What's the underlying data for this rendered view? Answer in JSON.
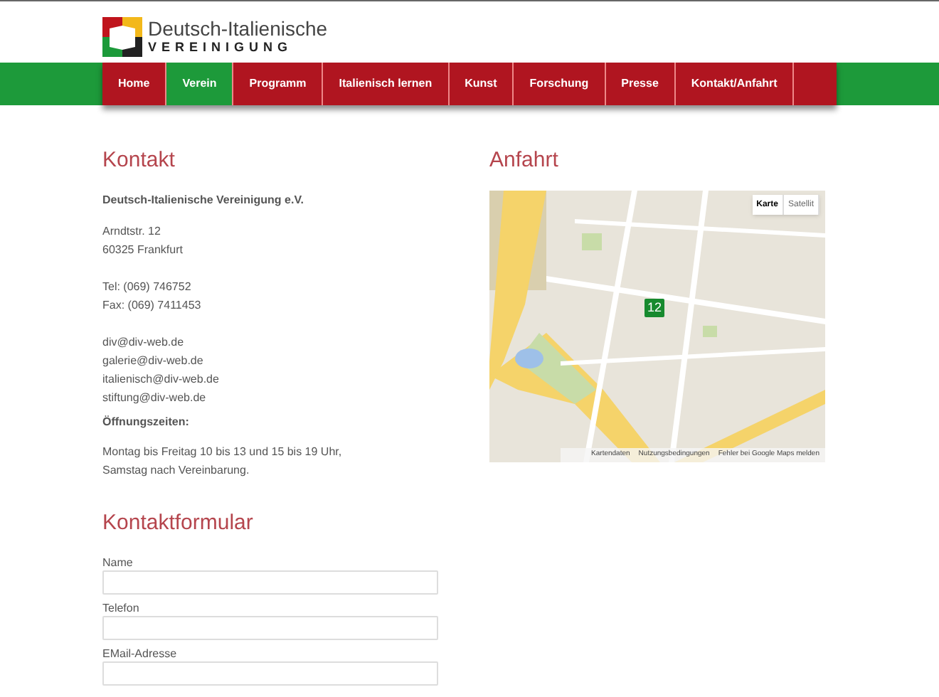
{
  "logo": {
    "line1": "Deutsch-Italienische",
    "line2": "VEREINIGUNG"
  },
  "nav": [
    {
      "label": "Home",
      "selected": false
    },
    {
      "label": "Verein",
      "selected": true
    },
    {
      "label": "Programm",
      "selected": false
    },
    {
      "label": "Italienisch lernen",
      "selected": false
    },
    {
      "label": "Kunst",
      "selected": false
    },
    {
      "label": "Forschung",
      "selected": false
    },
    {
      "label": "Presse",
      "selected": false
    },
    {
      "label": "Kontakt/Anfahrt",
      "selected": false
    }
  ],
  "contact": {
    "heading": "Kontakt",
    "org": "Deutsch-Italienische Vereinigung e.V.",
    "address": [
      "Arndtstr. 12",
      "60325 Frankfurt"
    ],
    "phones": [
      "Tel: (069) 746752",
      "Fax: (069) 7411453"
    ],
    "emails": [
      "div@div-web.de",
      "galerie@div-web.de",
      "italienisch@div-web.de",
      "stiftung@div-web.de"
    ],
    "hours_label": "Öffnungszeiten:",
    "hours": [
      "Montag bis Freitag 10 bis 13 und 15 bis 19 Uhr,",
      "Samstag nach Vereinbarung."
    ]
  },
  "map_section": {
    "heading": "Anfahrt",
    "map_types": [
      {
        "label": "Karte",
        "selected": true
      },
      {
        "label": "Satellit",
        "selected": false
      }
    ],
    "marker": "12",
    "footer_links": [
      "Kartendaten",
      "Nutzungsbedingungen",
      "Fehler bei Google Maps melden"
    ]
  },
  "form": {
    "heading": "Kontaktformular",
    "fields": [
      {
        "label": "Name"
      },
      {
        "label": "Telefon"
      },
      {
        "label": "EMail-Adresse"
      }
    ]
  }
}
